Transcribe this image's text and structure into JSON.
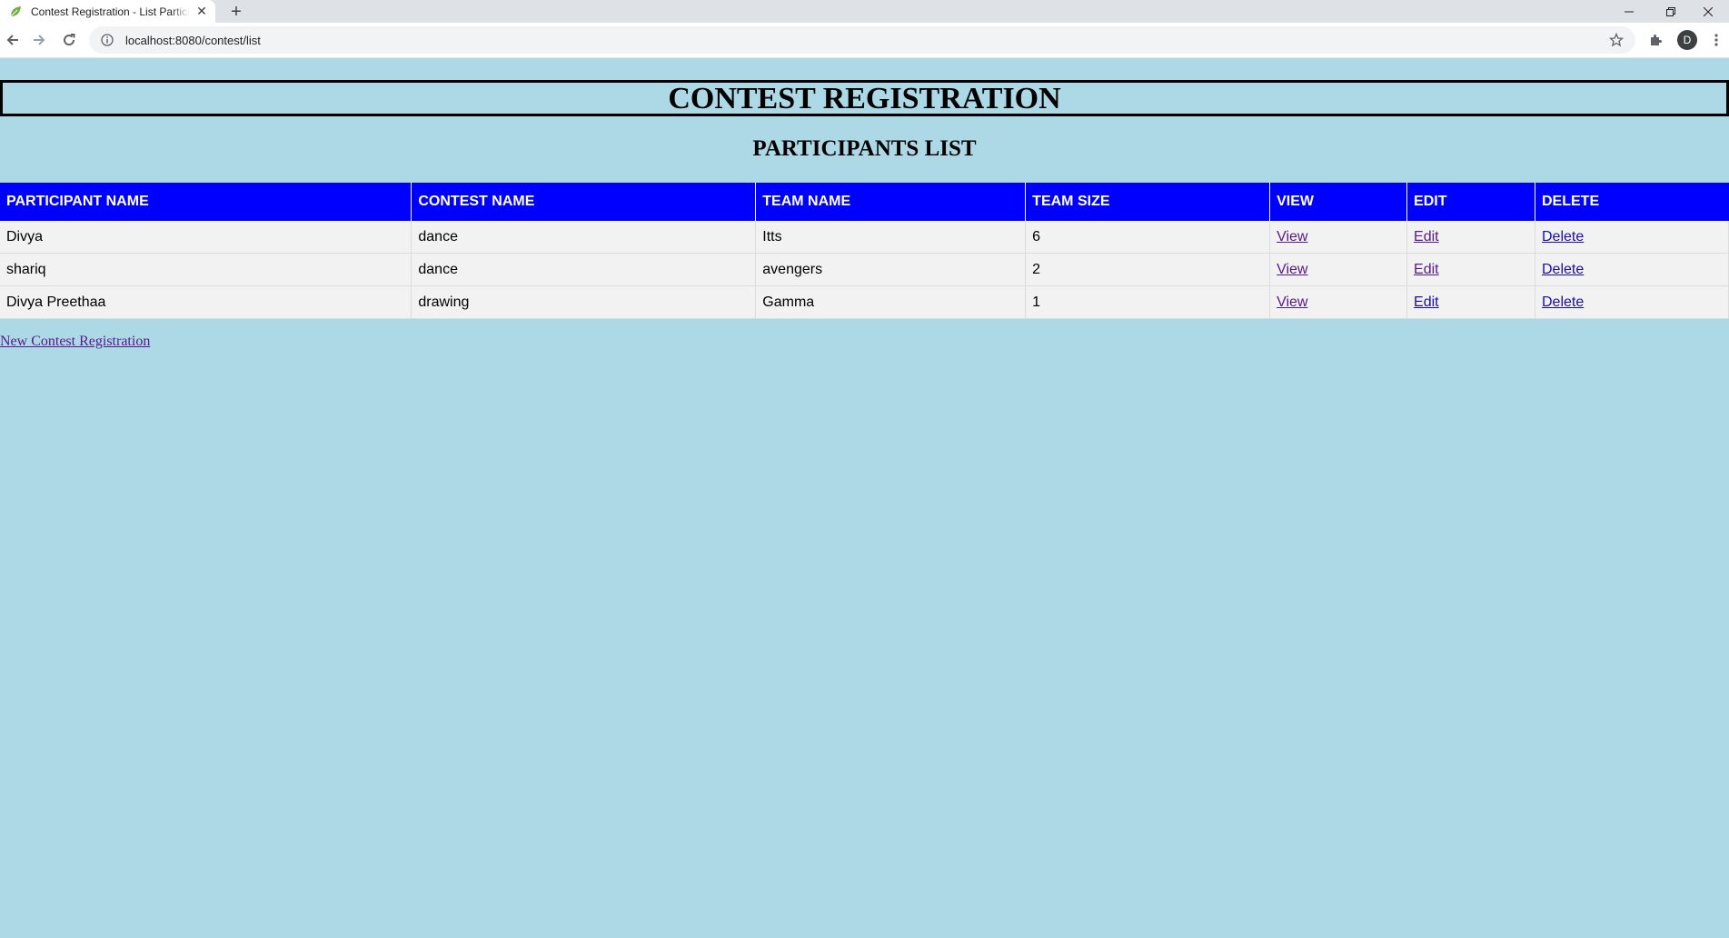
{
  "browser": {
    "tab_title": "Contest Registration - List Participants",
    "url": "localhost:8080/contest/list",
    "profile_initial": "D",
    "window_controls": [
      "minimize",
      "restore",
      "close"
    ]
  },
  "page": {
    "heading": "CONTEST REGISTRATION",
    "subheading": "PARTICIPANTS LIST",
    "new_link": "New Contest Registration"
  },
  "table": {
    "columns": [
      "PARTICIPANT NAME",
      "CONTEST NAME",
      "TEAM NAME",
      "TEAM SIZE",
      "VIEW",
      "EDIT",
      "DELETE"
    ],
    "rows": [
      {
        "participant": "Divya",
        "contest": "dance",
        "team": "Itts",
        "size": "6",
        "view": "View",
        "edit": "Edit",
        "delete": "Delete"
      },
      {
        "participant": "shariq",
        "contest": "dance",
        "team": "avengers",
        "size": "2",
        "view": "View",
        "edit": "Edit",
        "delete": "Delete"
      },
      {
        "participant": "Divya Preethaa",
        "contest": "drawing",
        "team": "Gamma",
        "size": "1",
        "view": "View",
        "edit": "Edit",
        "delete": "Delete"
      }
    ]
  },
  "colors": {
    "page_background": "#add8e6",
    "header_background": "#0000ff",
    "row_background": "#f2f2f2"
  },
  "icons": {
    "favicon": "leaf-icon",
    "back": "back-arrow-icon",
    "forward": "forward-arrow-icon",
    "reload": "reload-icon",
    "site_info": "info-icon",
    "bookmark": "star-icon",
    "extensions": "puzzle-icon",
    "menu": "kebab-menu-icon"
  }
}
